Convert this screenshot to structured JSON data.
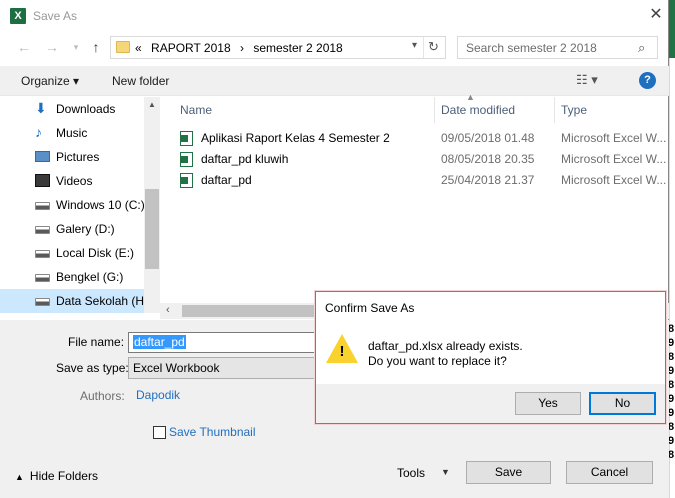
{
  "window": {
    "title": "Save As",
    "app_icon": "excel-icon"
  },
  "address": {
    "crumbs": [
      "«",
      "RAPORT 2018",
      "›",
      "semester 2 2018"
    ]
  },
  "search": {
    "placeholder": "Search semester 2 2018"
  },
  "toolbar": {
    "organize": "Organize ▾",
    "new_folder": "New folder"
  },
  "navpane": {
    "items": [
      {
        "label": "Downloads",
        "icon": "download-icon"
      },
      {
        "label": "Music",
        "icon": "music-icon"
      },
      {
        "label": "Pictures",
        "icon": "pictures-icon"
      },
      {
        "label": "Videos",
        "icon": "videos-icon"
      },
      {
        "label": "Windows 10 (C:)",
        "icon": "drive-icon"
      },
      {
        "label": "Galery (D:)",
        "icon": "drive-icon"
      },
      {
        "label": "Local Disk (E:)",
        "icon": "drive-icon"
      },
      {
        "label": "Bengkel (G:)",
        "icon": "drive-icon"
      },
      {
        "label": "Data Sekolah (H:",
        "icon": "drive-icon",
        "selected": true
      }
    ]
  },
  "filelist": {
    "columns": {
      "name": "Name",
      "date": "Date modified",
      "type": "Type"
    },
    "rows": [
      {
        "name": "Aplikasi Raport Kelas 4 Semester 2",
        "date": "09/05/2018 01.48",
        "type": "Microsoft Excel W..."
      },
      {
        "name": "daftar_pd kluwih",
        "date": "08/05/2018 20.35",
        "type": "Microsoft Excel W..."
      },
      {
        "name": "daftar_pd",
        "date": "25/04/2018 21.37",
        "type": "Microsoft Excel W..."
      }
    ]
  },
  "form": {
    "file_name_label": "File name:",
    "file_name_value": "daftar_pd",
    "save_as_type_label": "Save as type:",
    "save_as_type_value": "Excel Workbook",
    "authors_label": "Authors:",
    "authors_value": "Dapodik",
    "thumbnail_label": "Save Thumbnail",
    "hide_folders": "Hide Folders",
    "tools": "Tools",
    "save": "Save",
    "cancel": "Cancel"
  },
  "confirm": {
    "title": "Confirm Save As",
    "line1": "daftar_pd.xlsx already exists.",
    "line2": "Do you want to replace it?",
    "yes": "Yes",
    "no": "No"
  },
  "background": {
    "digits": [
      "8",
      "9",
      "8",
      "9",
      "8",
      "9",
      "9",
      "8",
      "9",
      "8"
    ]
  }
}
